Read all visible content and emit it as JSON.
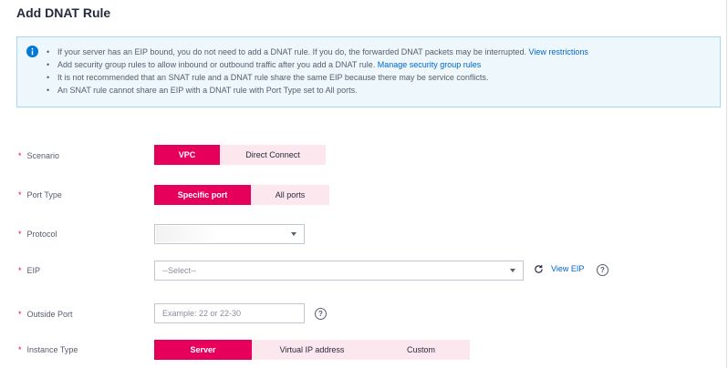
{
  "page": {
    "title": "Add DNAT Rule"
  },
  "notice": {
    "items": [
      {
        "text": "If your server has an EIP bound, you do not need to add a DNAT rule. If you do, the forwarded DNAT packets may be interrupted.",
        "link": "View restrictions"
      },
      {
        "text": "Add security group rules to allow inbound or outbound traffic after you add a DNAT rule.",
        "link": "Manage security group rules"
      },
      {
        "text": "It is not recommended that an SNAT rule and a DNAT rule share the same EIP because there may be service conflicts.",
        "link": ""
      },
      {
        "text": "An SNAT rule cannot share an EIP with a DNAT rule with Port Type set to All ports.",
        "link": ""
      }
    ]
  },
  "form": {
    "required_mark": "*",
    "scenario": {
      "label": "Scenario",
      "options": [
        "VPC",
        "Direct Connect"
      ],
      "selected": "VPC"
    },
    "port_type": {
      "label": "Port Type",
      "options": [
        "Specific port",
        "All ports"
      ],
      "selected": "Specific port"
    },
    "protocol": {
      "label": "Protocol",
      "value": ""
    },
    "eip": {
      "label": "EIP",
      "placeholder": "--Select--",
      "refresh_link": "View EIP",
      "help": "?"
    },
    "outside_port": {
      "label": "Outside Port",
      "placeholder": "Example: 22 or 22-30",
      "help": "?"
    },
    "instance_type": {
      "label": "Instance Type",
      "options": [
        "Server",
        "Virtual IP address",
        "Custom"
      ],
      "selected": "Server"
    }
  },
  "colors": {
    "accent": "#e6005c",
    "link": "#0066cc",
    "notice_bg": "#eef7fc",
    "notice_border": "#a8d6f5"
  }
}
